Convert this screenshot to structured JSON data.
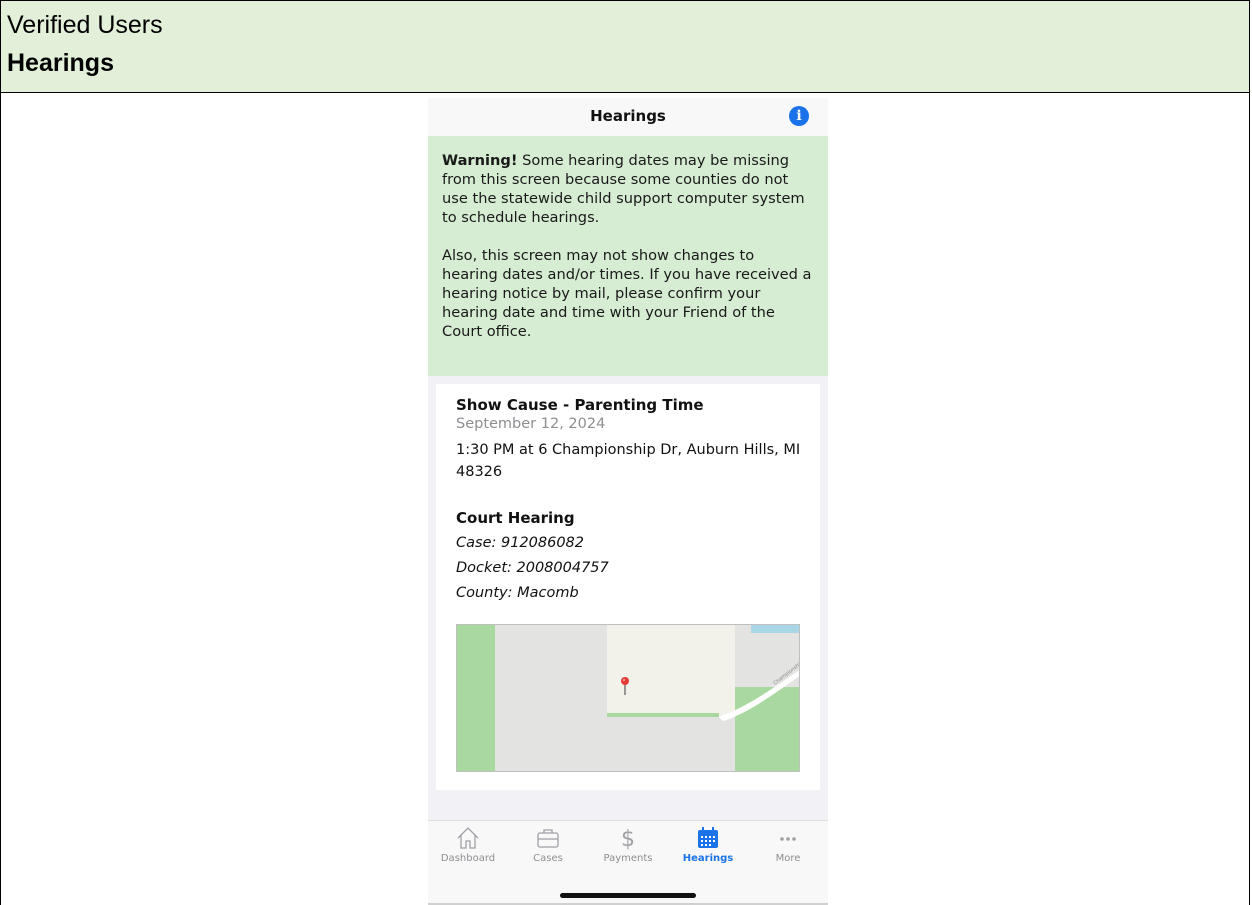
{
  "document": {
    "section": "Verified Users",
    "title": "Hearings"
  },
  "app": {
    "nav_title": "Hearings",
    "info_icon": "info-icon",
    "warning": {
      "label": "Warning!",
      "text1": " Some hearing dates may be missing from this screen because some counties do not use the statewide child support computer system to schedule hearings.",
      "text2": "Also, this screen may not show changes to hearing dates and/or times. If you have received a hearing notice by mail, please confirm your hearing date and time with your Friend of the Court office."
    },
    "hearing": {
      "title": "Show Cause - Parenting Time",
      "date": "September 12, 2024",
      "time_location": "1:30 PM at 6 Championship Dr, Auburn Hills, MI 48326",
      "type": "Court Hearing",
      "case": "Case: 912086082",
      "docket": "Docket: 2008004757",
      "county": "County: Macomb"
    },
    "map": {
      "street_label": "Championship Dr"
    },
    "tabs": [
      {
        "label": "Dashboard",
        "icon": "home-icon",
        "active": false
      },
      {
        "label": "Cases",
        "icon": "briefcase-icon",
        "active": false
      },
      {
        "label": "Payments",
        "icon": "dollar-icon",
        "active": false
      },
      {
        "label": "Hearings",
        "icon": "calendar-icon",
        "active": true
      },
      {
        "label": "More",
        "icon": "more-icon",
        "active": false
      }
    ],
    "colors": {
      "accent": "#1a73e8",
      "warning_bg": "#d6ecd3",
      "header_bg": "#e2efd9"
    }
  }
}
